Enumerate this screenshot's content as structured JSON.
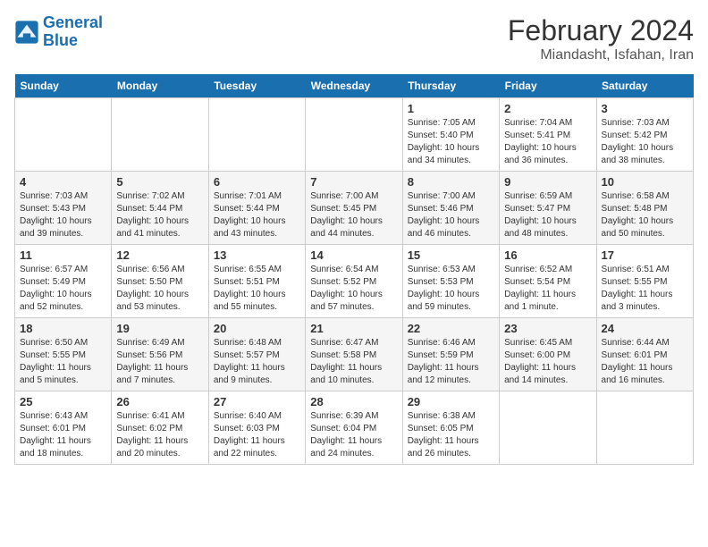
{
  "logo": {
    "line1": "General",
    "line2": "Blue"
  },
  "title": "February 2024",
  "location": "Miandasht, Isfahan, Iran",
  "weekdays": [
    "Sunday",
    "Monday",
    "Tuesday",
    "Wednesday",
    "Thursday",
    "Friday",
    "Saturday"
  ],
  "weeks": [
    [
      {
        "day": "",
        "info": ""
      },
      {
        "day": "",
        "info": ""
      },
      {
        "day": "",
        "info": ""
      },
      {
        "day": "",
        "info": ""
      },
      {
        "day": "1",
        "info": "Sunrise: 7:05 AM\nSunset: 5:40 PM\nDaylight: 10 hours\nand 34 minutes."
      },
      {
        "day": "2",
        "info": "Sunrise: 7:04 AM\nSunset: 5:41 PM\nDaylight: 10 hours\nand 36 minutes."
      },
      {
        "day": "3",
        "info": "Sunrise: 7:03 AM\nSunset: 5:42 PM\nDaylight: 10 hours\nand 38 minutes."
      }
    ],
    [
      {
        "day": "4",
        "info": "Sunrise: 7:03 AM\nSunset: 5:43 PM\nDaylight: 10 hours\nand 39 minutes."
      },
      {
        "day": "5",
        "info": "Sunrise: 7:02 AM\nSunset: 5:44 PM\nDaylight: 10 hours\nand 41 minutes."
      },
      {
        "day": "6",
        "info": "Sunrise: 7:01 AM\nSunset: 5:44 PM\nDaylight: 10 hours\nand 43 minutes."
      },
      {
        "day": "7",
        "info": "Sunrise: 7:00 AM\nSunset: 5:45 PM\nDaylight: 10 hours\nand 44 minutes."
      },
      {
        "day": "8",
        "info": "Sunrise: 7:00 AM\nSunset: 5:46 PM\nDaylight: 10 hours\nand 46 minutes."
      },
      {
        "day": "9",
        "info": "Sunrise: 6:59 AM\nSunset: 5:47 PM\nDaylight: 10 hours\nand 48 minutes."
      },
      {
        "day": "10",
        "info": "Sunrise: 6:58 AM\nSunset: 5:48 PM\nDaylight: 10 hours\nand 50 minutes."
      }
    ],
    [
      {
        "day": "11",
        "info": "Sunrise: 6:57 AM\nSunset: 5:49 PM\nDaylight: 10 hours\nand 52 minutes."
      },
      {
        "day": "12",
        "info": "Sunrise: 6:56 AM\nSunset: 5:50 PM\nDaylight: 10 hours\nand 53 minutes."
      },
      {
        "day": "13",
        "info": "Sunrise: 6:55 AM\nSunset: 5:51 PM\nDaylight: 10 hours\nand 55 minutes."
      },
      {
        "day": "14",
        "info": "Sunrise: 6:54 AM\nSunset: 5:52 PM\nDaylight: 10 hours\nand 57 minutes."
      },
      {
        "day": "15",
        "info": "Sunrise: 6:53 AM\nSunset: 5:53 PM\nDaylight: 10 hours\nand 59 minutes."
      },
      {
        "day": "16",
        "info": "Sunrise: 6:52 AM\nSunset: 5:54 PM\nDaylight: 11 hours\nand 1 minute."
      },
      {
        "day": "17",
        "info": "Sunrise: 6:51 AM\nSunset: 5:55 PM\nDaylight: 11 hours\nand 3 minutes."
      }
    ],
    [
      {
        "day": "18",
        "info": "Sunrise: 6:50 AM\nSunset: 5:55 PM\nDaylight: 11 hours\nand 5 minutes."
      },
      {
        "day": "19",
        "info": "Sunrise: 6:49 AM\nSunset: 5:56 PM\nDaylight: 11 hours\nand 7 minutes."
      },
      {
        "day": "20",
        "info": "Sunrise: 6:48 AM\nSunset: 5:57 PM\nDaylight: 11 hours\nand 9 minutes."
      },
      {
        "day": "21",
        "info": "Sunrise: 6:47 AM\nSunset: 5:58 PM\nDaylight: 11 hours\nand 10 minutes."
      },
      {
        "day": "22",
        "info": "Sunrise: 6:46 AM\nSunset: 5:59 PM\nDaylight: 11 hours\nand 12 minutes."
      },
      {
        "day": "23",
        "info": "Sunrise: 6:45 AM\nSunset: 6:00 PM\nDaylight: 11 hours\nand 14 minutes."
      },
      {
        "day": "24",
        "info": "Sunrise: 6:44 AM\nSunset: 6:01 PM\nDaylight: 11 hours\nand 16 minutes."
      }
    ],
    [
      {
        "day": "25",
        "info": "Sunrise: 6:43 AM\nSunset: 6:01 PM\nDaylight: 11 hours\nand 18 minutes."
      },
      {
        "day": "26",
        "info": "Sunrise: 6:41 AM\nSunset: 6:02 PM\nDaylight: 11 hours\nand 20 minutes."
      },
      {
        "day": "27",
        "info": "Sunrise: 6:40 AM\nSunset: 6:03 PM\nDaylight: 11 hours\nand 22 minutes."
      },
      {
        "day": "28",
        "info": "Sunrise: 6:39 AM\nSunset: 6:04 PM\nDaylight: 11 hours\nand 24 minutes."
      },
      {
        "day": "29",
        "info": "Sunrise: 6:38 AM\nSunset: 6:05 PM\nDaylight: 11 hours\nand 26 minutes."
      },
      {
        "day": "",
        "info": ""
      },
      {
        "day": "",
        "info": ""
      }
    ]
  ]
}
